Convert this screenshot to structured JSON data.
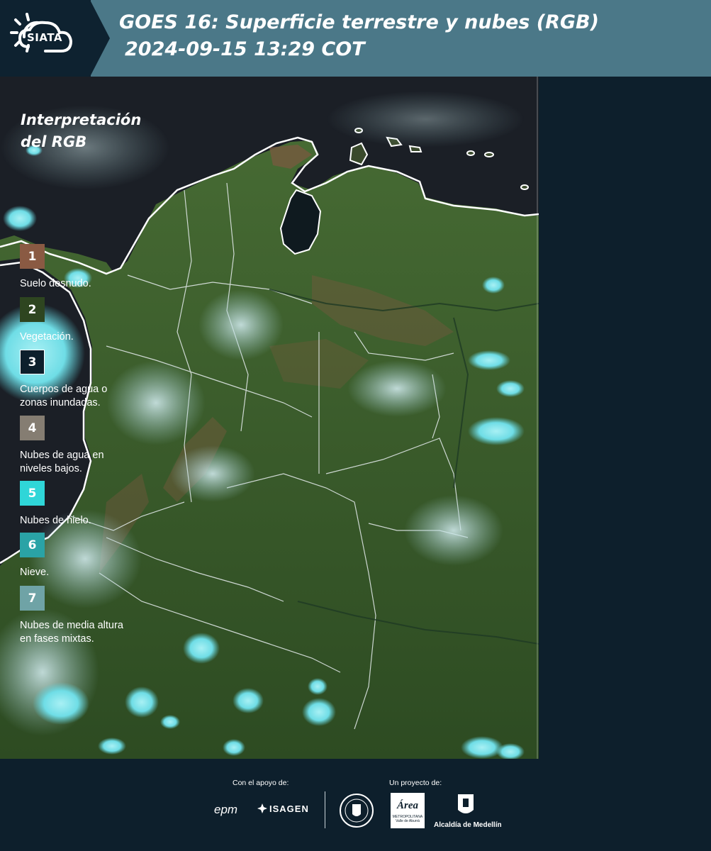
{
  "header": {
    "logo": "SIATA",
    "title_line1": "GOES 16: Superficie terrestre y nubes (RGB)",
    "title_line2": "2024-09-15 13:29 COT"
  },
  "legend": {
    "title_line1": "Interpretación",
    "title_line2": "del RGB",
    "items": [
      {
        "number": "1",
        "label_line1": "Suelo desnudo.",
        "label_line2": "",
        "color": "#8a5a43",
        "border": ""
      },
      {
        "number": "2",
        "label_line1": "Vegetación.",
        "label_line2": "",
        "color": "#2e4520",
        "border": ""
      },
      {
        "number": "3",
        "label_line1": "Cuerpos de agua o",
        "label_line2": "zonas inundadas.",
        "color": "#0d1f2c",
        "border": "#ffffff"
      },
      {
        "number": "4",
        "label_line1": "Nubes de agua en",
        "label_line2": "niveles bajos.",
        "color": "#857d72",
        "border": ""
      },
      {
        "number": "5",
        "label_line1": "Nubes de hielo.",
        "label_line2": "",
        "color": "#2fd6d8",
        "border": ""
      },
      {
        "number": "6",
        "label_line1": "Nieve.",
        "label_line2": "",
        "color": "#2aa3a6",
        "border": ""
      },
      {
        "number": "7",
        "label_line1": "Nubes de media altura",
        "label_line2": "en fases mixtas.",
        "color": "#6fa3a6",
        "border": ""
      }
    ]
  },
  "footer": {
    "support_label": "Con el apoyo de:",
    "project_label": "Un proyecto de:",
    "sponsors": [
      "epm",
      "ISAGEN"
    ],
    "partners": [
      "Área Metropolitana Valle de Aburrá",
      "Alcaldía de Medellín"
    ],
    "area_logo_text": "Área",
    "area_logo_sub1": "METROPOLITANA",
    "area_logo_sub2": "Valle de Aburrá",
    "medellin_logo_text": "Alcaldía de Medellín"
  },
  "colors": {
    "header_bg": "#4b7888",
    "logo_bg": "#0e2230",
    "sidebar_bg": "#0d1f2c",
    "ocean": "#1a1f26",
    "vegetation": "#3c5a2c",
    "bare_soil": "#7a5a40",
    "ice_cloud": "#7fe6ec"
  },
  "icons": [
    "sun-logo-icon",
    "cloud-logo-icon",
    "university-seal-icon",
    "area-metropolitana-logo-icon",
    "alcaldia-shield-icon"
  ]
}
